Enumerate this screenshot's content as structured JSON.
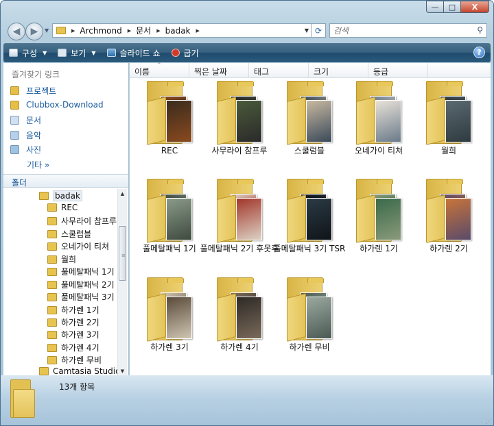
{
  "window": {
    "controls": {
      "minimize": "—",
      "maximize": "□",
      "close": "X"
    }
  },
  "address": {
    "crumbs": [
      "Archmond",
      "문서",
      "badak"
    ],
    "dropdown": "▼",
    "refresh": "⟳"
  },
  "search": {
    "placeholder": "검색",
    "icon": "magnifier-icon"
  },
  "toolbar": {
    "organize": "구성",
    "views": "보기",
    "slideshow": "슬라이드 쇼",
    "burn": "굽기",
    "help": "?"
  },
  "favorites": {
    "header": "즐겨찾기 링크",
    "items": [
      "프로젝트",
      "Clubbox-Download",
      "문서",
      "음악",
      "사진"
    ],
    "more": "기타 »"
  },
  "folders": {
    "header": "폴더",
    "tree": [
      "badak",
      "REC",
      "사무라이 참프루",
      "스쿨럼블",
      "오네가이 티쳐",
      "월희",
      "풀메탈패닉 1기",
      "풀메탈패닉 2기",
      "풀메탈패닉 3기",
      "하가렌 1기",
      "하가렌 2기",
      "하가렌 3기",
      "하가렌 4기",
      "하가렌 무비",
      "Camtasia Studio"
    ]
  },
  "columns": [
    "이름",
    "찍은 날짜",
    "태그",
    "크기",
    "등급"
  ],
  "items": [
    {
      "name": "REC",
      "c1": "#3a2b1e",
      "c2": "#8a4a1e"
    },
    {
      "name": "사무라이 참프루",
      "c1": "#4a5a3a",
      "c2": "#2a2a2a"
    },
    {
      "name": "스쿨럼블",
      "c1": "#c8b8a0",
      "c2": "#3a4a5a"
    },
    {
      "name": "오네가이 티쳐",
      "c1": "#e8e2d8",
      "c2": "#6a7a8a"
    },
    {
      "name": "월희",
      "c1": "#5a6a70",
      "c2": "#2e3a40"
    },
    {
      "name": "풀메탈패닉 1기",
      "c1": "#8a9a8a",
      "c2": "#3e4a3e"
    },
    {
      "name": "풀메탈패닉 2기 후못후",
      "c1": "#a2362a",
      "c2": "#dcd2c4"
    },
    {
      "name": "풀메탈패닉 3기 TSR",
      "c1": "#2a3a44",
      "c2": "#101418"
    },
    {
      "name": "하가렌 1기",
      "c1": "#3a6a4a",
      "c2": "#8a9a7a"
    },
    {
      "name": "하가렌 2기",
      "c1": "#c8743a",
      "c2": "#5a4a6a"
    },
    {
      "name": "하가렌 3기",
      "c1": "#5a4a3a",
      "c2": "#cfc6b2"
    },
    {
      "name": "하가렌 4기",
      "c1": "#2e2a26",
      "c2": "#7a6a5a"
    },
    {
      "name": "하가렌 무비",
      "c1": "#9aa8a0",
      "c2": "#4a5a52"
    }
  ],
  "status": {
    "count": "13개 항목"
  }
}
